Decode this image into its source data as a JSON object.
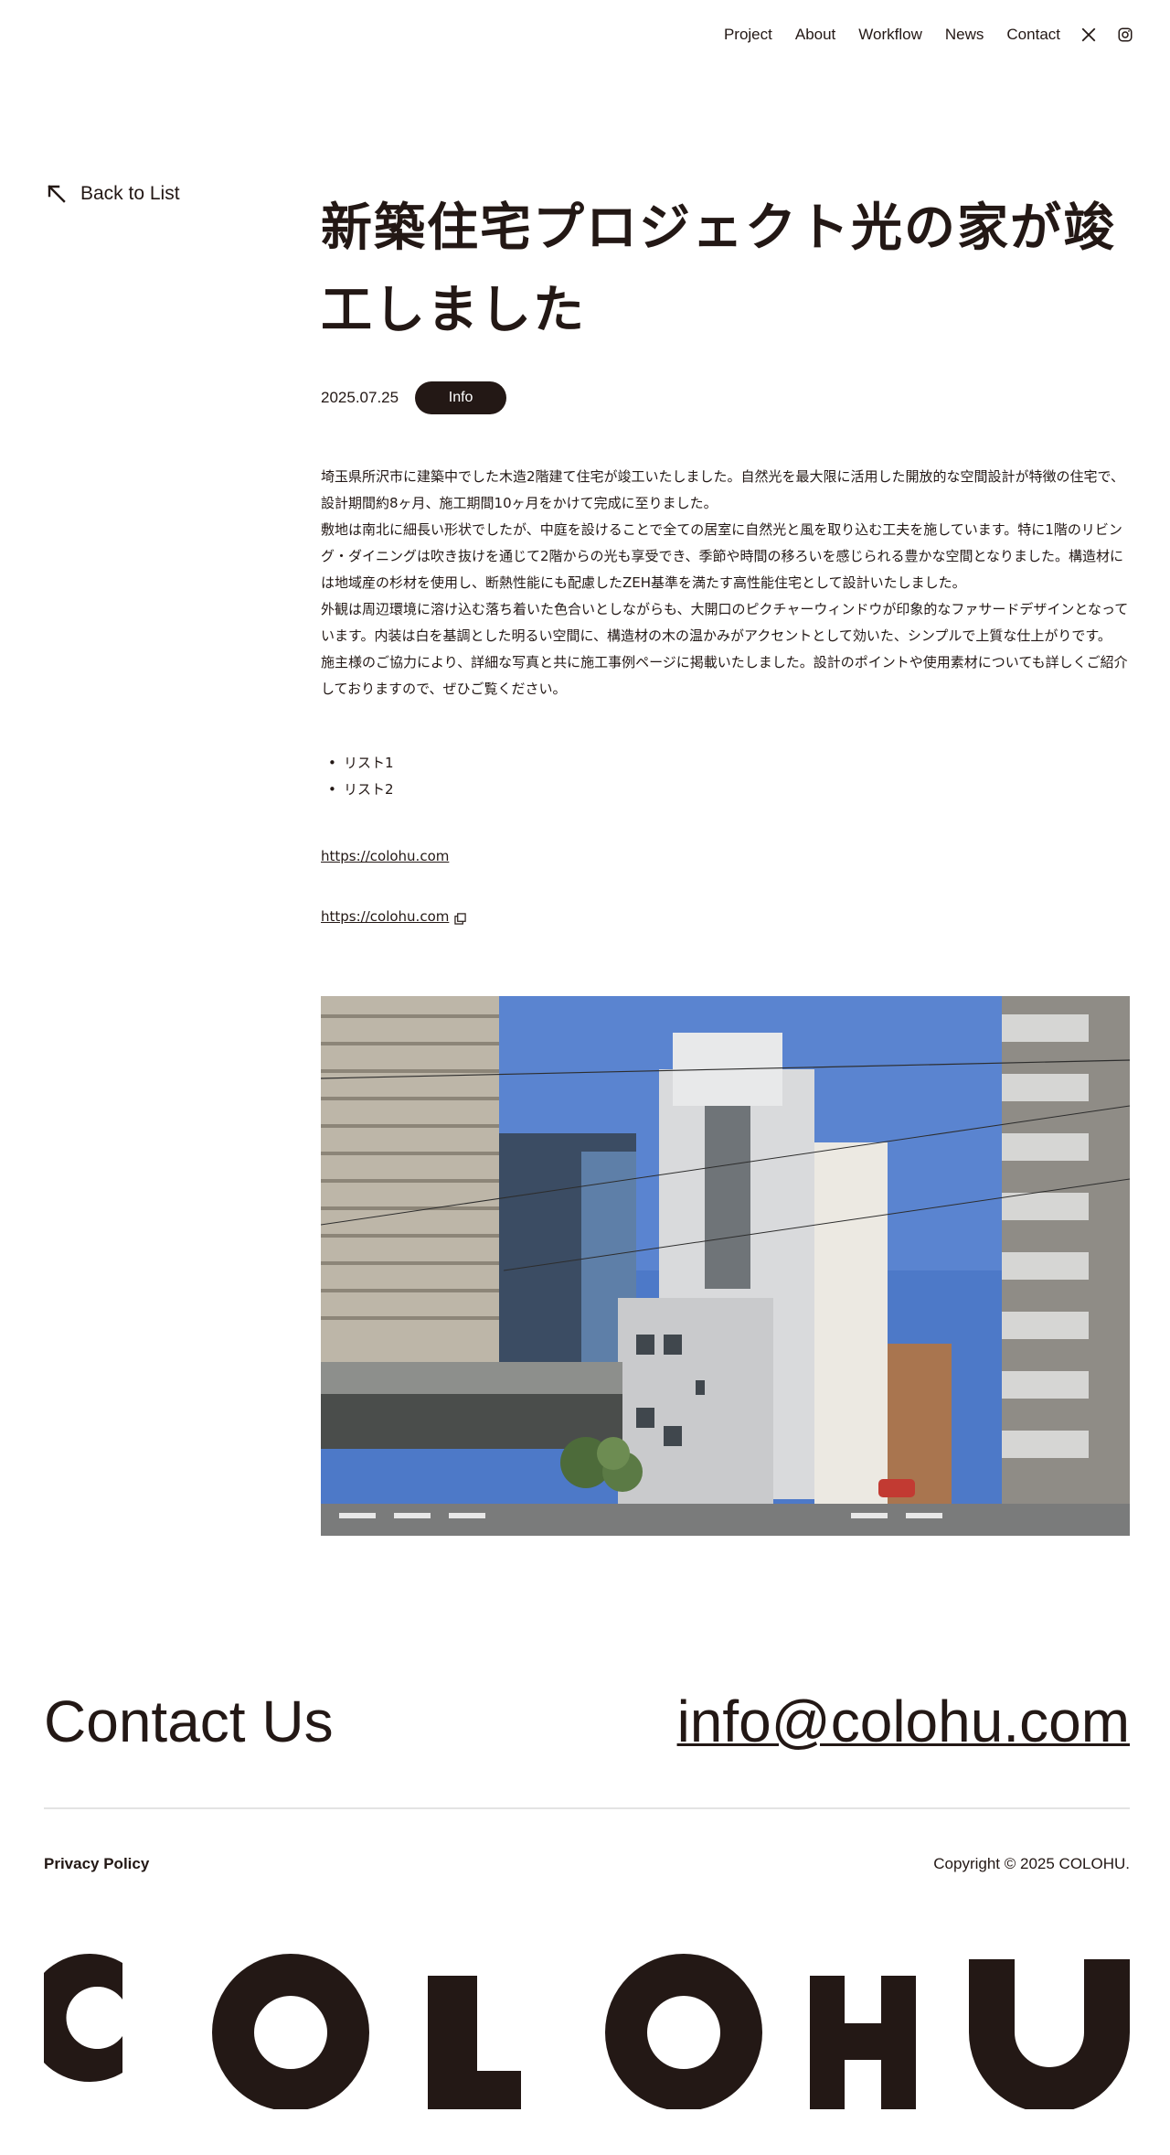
{
  "nav": {
    "items": [
      "Project",
      "About",
      "Workflow",
      "News",
      "Contact"
    ],
    "social": [
      "x-icon",
      "instagram-icon"
    ]
  },
  "back": {
    "label": "Back to List",
    "icon": "arrow-up-left-icon"
  },
  "article": {
    "title": "新築住宅プロジェクト光の家が竣工しました",
    "date": "2025.07.25",
    "tag": "Info",
    "paragraphs": [
      "埼玉県所沢市に建築中でした木造2階建て住宅が竣工いたしました。自然光を最大限に活用した開放的な空間設計が特徴の住宅で、設計期間約8ヶ月、施工期間10ヶ月をかけて完成に至りました。",
      "敷地は南北に細長い形状でしたが、中庭を設けることで全ての居室に自然光と風を取り込む工夫を施しています。特に1階のリビング・ダイニングは吹き抜けを通じて2階からの光も享受でき、季節や時間の移ろいを感じられる豊かな空間となりました。構造材には地域産の杉材を使用し、断熱性能にも配慮したZEH基準を満たす高性能住宅として設計いたしました。",
      "外観は周辺環境に溶け込む落ち着いた色合いとしながらも、大開口のピクチャーウィンドウが印象的なファサードデザインとなっています。内装は白を基調とした明るい空間に、構造材の木の温かみがアクセントとして効いた、シンプルで上質な仕上がりです。",
      "施主様のご協力により、詳細な写真と共に施工事例ページに掲載いたしました。設計のポイントや使用素材についても詳しくご紹介しておりますので、ぜひご覧ください。"
    ],
    "list": [
      "リスト1",
      "リスト2"
    ],
    "link1": "https://colohu.com",
    "link2": "https://colohu.com",
    "link2_icon": "external-link-icon",
    "photo_icon": "building-photo"
  },
  "contact": {
    "title": "Contact Us",
    "email": "info@colohu.com"
  },
  "footer": {
    "privacy": "Privacy Policy",
    "copyright": "Copyright © 2025 COLOHU.",
    "logo": "COLOHU"
  },
  "colors": {
    "ink": "#231815",
    "sky": "#4d79c8"
  }
}
